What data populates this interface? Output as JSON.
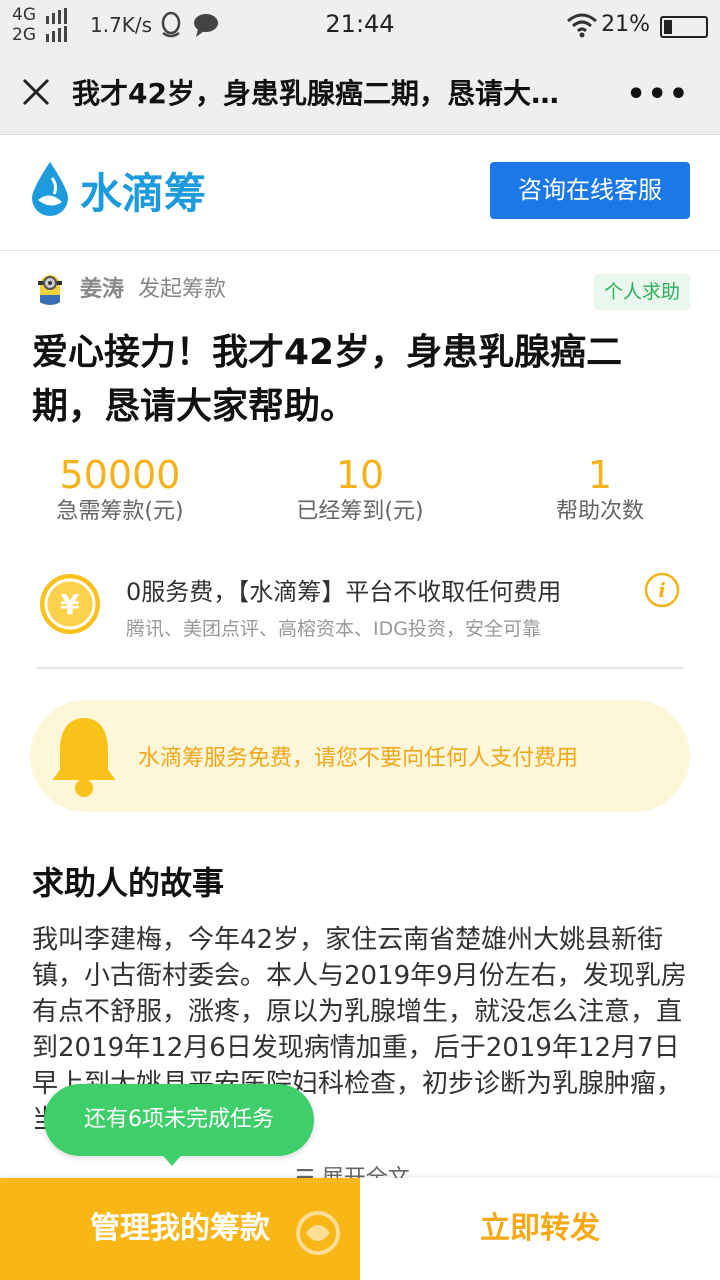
{
  "status_bar": {
    "network_top": "4G",
    "network_bottom": "2G",
    "speed": "1.7K/s",
    "time": "21:44",
    "battery": "21%",
    "battery_level": 0.21
  },
  "title_bar": {
    "title": "我才42岁，身患乳腺癌二期，恳请大…",
    "more": "•••"
  },
  "header": {
    "brand": "水滴筹",
    "service_button": "咨询在线客服"
  },
  "initiator": {
    "name": "姜涛",
    "action": "发起筹款",
    "tag": "个人求助"
  },
  "campaign": {
    "title": "爱心接力！我才42岁，身患乳腺癌二期，恳请大家帮助。"
  },
  "stats": [
    {
      "value": "50000",
      "label": "急需筹款(元)"
    },
    {
      "value": "10",
      "label": "已经筹到(元)"
    },
    {
      "value": "1",
      "label": "帮助次数"
    }
  ],
  "fee": {
    "main": "0服务费，【水滴筹】平台不收取任何费用",
    "sub": "腾讯、美团点评、高榕资本、IDG投资，安全可靠",
    "yen": "¥",
    "info": "i"
  },
  "notice": {
    "text": "水滴筹服务免费，请您不要向任何人支付费用"
  },
  "story": {
    "heading": "求助人的故事",
    "text": "我叫李建梅，今年42岁，家住云南省楚雄州大姚县新街镇，小古衙村委会。本人与2019年9月份左右，发现乳房有点不舒服，涨疼，原以为乳腺增生，就没怎么注意，直到2019年12月6日发现病情加重，后于2019年12月7日早上到大姚县平安医院妇科检查，初步诊断为乳腺肿瘤，当天立即住院，",
    "expand": "☰ 展开全文"
  },
  "toast": {
    "text": "还有6项未完成任务"
  },
  "bottom_bar": {
    "manage": "管理我的筹款",
    "share": "立即转发"
  },
  "colors": {
    "brand_blue": "#1d9bdc",
    "button_blue": "#1b78e8",
    "accent_yellow": "#f9b617",
    "toast_green": "#3fcf6a",
    "tag_green": "#2fb15b"
  }
}
